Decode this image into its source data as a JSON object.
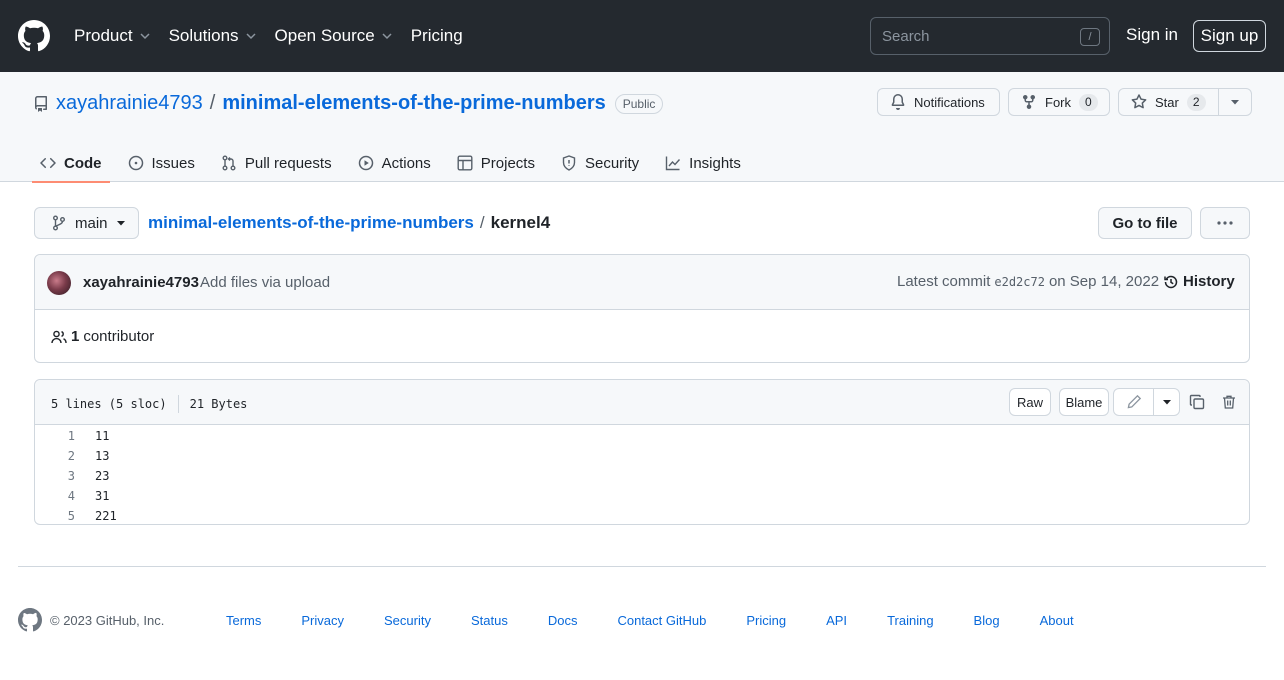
{
  "header": {
    "nav": [
      {
        "label": "Product",
        "dropdown": true
      },
      {
        "label": "Solutions",
        "dropdown": true
      },
      {
        "label": "Open Source",
        "dropdown": true
      },
      {
        "label": "Pricing",
        "dropdown": false
      }
    ],
    "search_placeholder": "Search",
    "search_shortcut": "/",
    "sign_in": "Sign in",
    "sign_up": "Sign up"
  },
  "repo": {
    "owner": "xayahrainie4793",
    "separator": "/",
    "name": "minimal-elements-of-the-prime-numbers",
    "visibility": "Public",
    "notifications_label": "Notifications",
    "fork_label": "Fork",
    "fork_count": "0",
    "star_label": "Star",
    "star_count": "2"
  },
  "tabs": [
    {
      "label": "Code",
      "icon": "code-icon",
      "active": true
    },
    {
      "label": "Issues",
      "icon": "issue-icon",
      "active": false
    },
    {
      "label": "Pull requests",
      "icon": "pull-request-icon",
      "active": false
    },
    {
      "label": "Actions",
      "icon": "play-icon",
      "active": false
    },
    {
      "label": "Projects",
      "icon": "table-icon",
      "active": false
    },
    {
      "label": "Security",
      "icon": "shield-icon",
      "active": false
    },
    {
      "label": "Insights",
      "icon": "graph-icon",
      "active": false
    }
  ],
  "file_nav": {
    "branch": "main",
    "breadcrumb_repo": "minimal-elements-of-the-prime-numbers",
    "separator": "/",
    "file_name": "kernel4",
    "go_to_file": "Go to file"
  },
  "commit": {
    "author": "xayahrainie4793",
    "message": "Add files via upload",
    "latest_label": "Latest commit",
    "sha": "e2d2c72",
    "date": "on Sep 14, 2022",
    "history": "History",
    "contributor_count": "1",
    "contributor_label": "contributor"
  },
  "file": {
    "lines_info": "5 lines (5 sloc)",
    "size": "21 Bytes",
    "raw": "Raw",
    "blame": "Blame",
    "lines": [
      {
        "num": "1",
        "code": "11"
      },
      {
        "num": "2",
        "code": "13"
      },
      {
        "num": "3",
        "code": "23"
      },
      {
        "num": "4",
        "code": "31"
      },
      {
        "num": "5",
        "code": "221"
      }
    ]
  },
  "footer": {
    "copyright": "© 2023 GitHub, Inc.",
    "links": [
      "Terms",
      "Privacy",
      "Security",
      "Status",
      "Docs",
      "Contact GitHub",
      "Pricing",
      "API",
      "Training",
      "Blog",
      "About"
    ]
  },
  "colors": {
    "header_bg": "#24292f",
    "link": "#0969da",
    "active_tab_underline": "#fd8c73"
  }
}
